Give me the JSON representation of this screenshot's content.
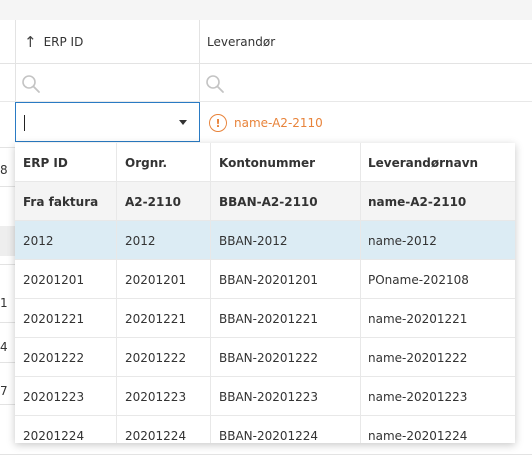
{
  "table": {
    "columns": [
      {
        "label": "ERP ID",
        "sorted": "ascending"
      },
      {
        "label": "Leverandør"
      }
    ],
    "left_row_numbers": [
      "8",
      "1",
      "4",
      "7"
    ]
  },
  "editor": {
    "select_value": "",
    "warning_text": "name-A2-2110",
    "warning_symbol": "!",
    "warning_color": "#e8833a",
    "accent_color": "#2a7bc4"
  },
  "dropdown": {
    "headers": [
      "ERP ID",
      "Orgnr.",
      "Kontonummer",
      "Leverandørnavn"
    ],
    "invoice_row": [
      "Fra faktura",
      "A2-2110",
      "BBAN-A2-2110",
      "name-A2-2110"
    ],
    "rows": [
      [
        "2012",
        "2012",
        "BBAN-2012",
        "name-2012"
      ],
      [
        "20201201",
        "20201201",
        "BBAN-20201201",
        "POname-202108"
      ],
      [
        "20201221",
        "20201221",
        "BBAN-20201221",
        "name-20201221"
      ],
      [
        "20201222",
        "20201222",
        "BBAN-20201222",
        "name-20201222"
      ],
      [
        "20201223",
        "20201223",
        "BBAN-20201223",
        "name-20201223"
      ],
      [
        "20201224",
        "20201224",
        "BBAN-20201224",
        "name-20201224"
      ]
    ],
    "selected_index": 0
  },
  "icons": {
    "sort": "arrow-up-icon",
    "search": "search-icon",
    "warning": "warning-circle-icon",
    "dropdown": "chevron-down-icon"
  }
}
